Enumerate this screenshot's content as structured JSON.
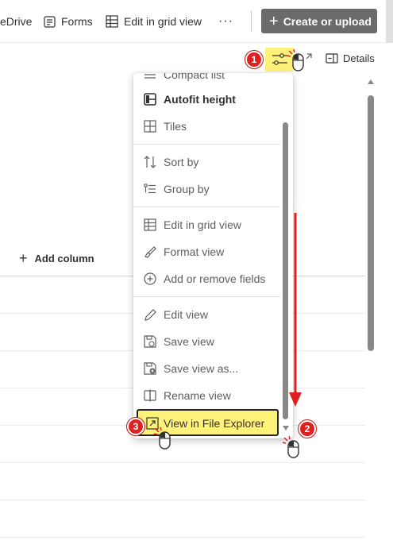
{
  "toolbar": {
    "onedrive_label": "eDrive",
    "forms_label": "Forms",
    "grid_label": "Edit in grid view",
    "more_label": "···",
    "create_label": "Create or upload"
  },
  "details_label": "Details",
  "add_column_label": "Add column",
  "menu": {
    "items": [
      {
        "label": "Compact list",
        "icon": "compact-list-icon"
      },
      {
        "label": "Autofit height",
        "icon": "autofit-icon"
      },
      {
        "label": "Tiles",
        "icon": "tiles-icon"
      },
      {
        "label": "Sort by",
        "icon": "sort-icon"
      },
      {
        "label": "Group by",
        "icon": "group-icon"
      },
      {
        "label": "Edit in grid view",
        "icon": "grid-icon"
      },
      {
        "label": "Format view",
        "icon": "format-brush-icon"
      },
      {
        "label": "Add or remove fields",
        "icon": "add-circle-icon"
      },
      {
        "label": "Edit view",
        "icon": "pencil-icon"
      },
      {
        "label": "Save view",
        "icon": "save-icon"
      },
      {
        "label": "Save view as...",
        "icon": "save-as-icon"
      },
      {
        "label": "Rename view",
        "icon": "rename-icon"
      },
      {
        "label": "View in File Explorer",
        "icon": "file-explorer-icon"
      }
    ]
  },
  "annotations": {
    "step1": "1",
    "step2": "2",
    "step3": "3"
  },
  "colors": {
    "highlight": "#fff27a",
    "badge": "#e02020",
    "create_button": "#6b6b6b"
  }
}
